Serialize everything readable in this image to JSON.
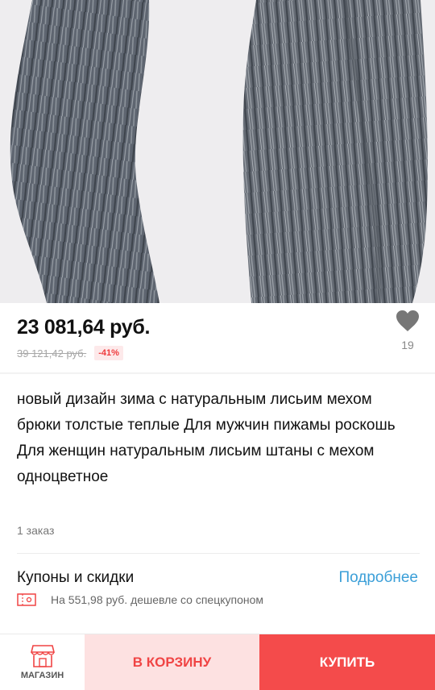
{
  "product": {
    "price": "23 081,64 руб.",
    "old_price": "39 121,42 руб.",
    "discount": "-41%",
    "likes": "19",
    "title": " новый дизайн зима с натуральным лисьим мехом брюки толстые теплые Для мужчин пижамы роскошь Для женщин натуральным лисьим штаны с мехом одноцветное",
    "orders": "1 заказ",
    "image_icon": "fur-pants-photo"
  },
  "coupons": {
    "title": "Купоны и скидки",
    "more": "Подробнее",
    "note": "На 551,98 руб. дешевле со спецкупоном",
    "icon": "coupon-icon"
  },
  "bottom_bar": {
    "store_label": "МАГАЗИН",
    "cart_label": "В КОРЗИНУ",
    "buy_label": "КУПИТЬ"
  },
  "colors": {
    "accent_red": "#f44b4b",
    "cart_bg": "#fde1e1",
    "link_blue": "#3b9fd8",
    "discount_red": "#ef3b3e"
  }
}
